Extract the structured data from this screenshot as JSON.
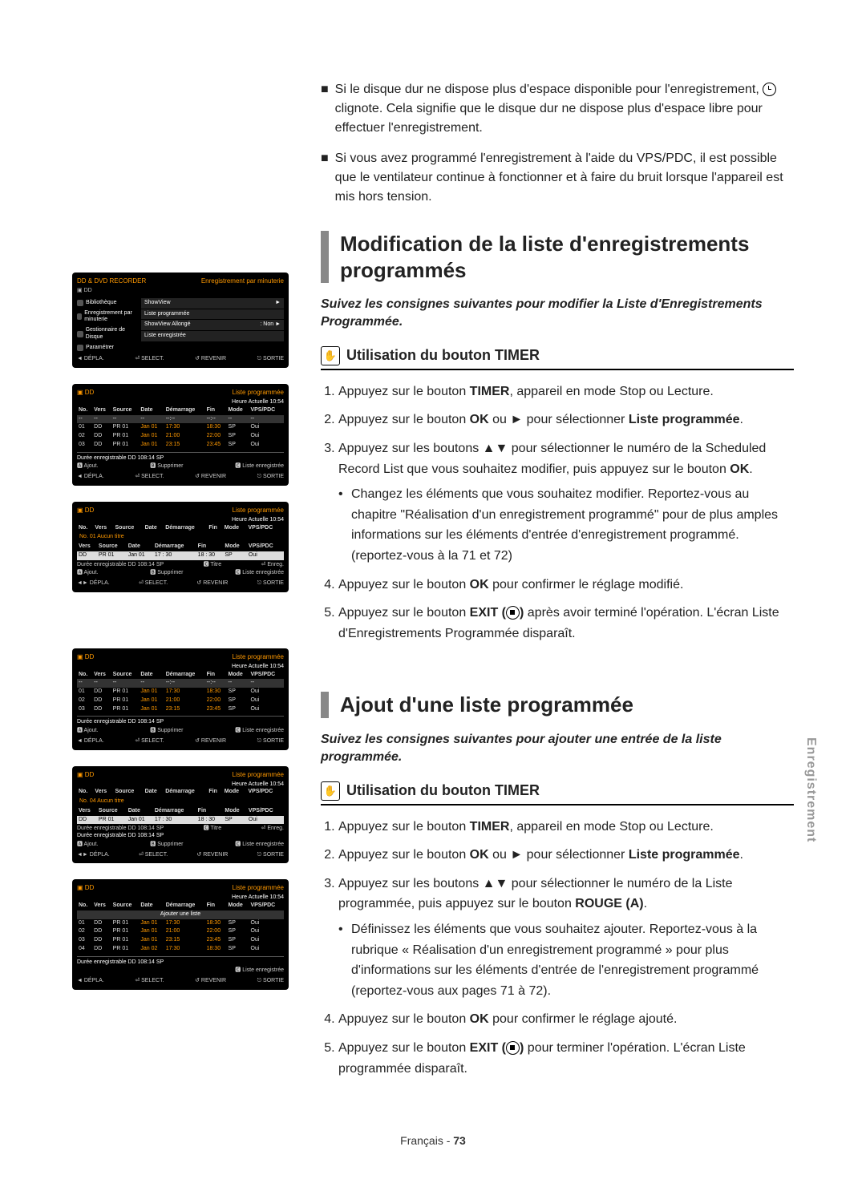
{
  "notes": [
    "Si le disque dur ne dispose plus d'espace disponible pour l'enregistrement, ⊕ clignote. Cela signifie que le disque dur ne dispose plus d'espace libre pour effectuer l'enregistrement.",
    "Si vous avez programmé l'enregistrement à l'aide du VPS/PDC, il est possible que le ventilateur continue à fonctionner et à faire du bruit lorsque l'appareil est mis hors tension."
  ],
  "section1": {
    "title": "Modification de la liste d'enregistrements programmés",
    "intro": "Suivez les consignes suivantes pour modifier la Liste d'Enregistrements Programmée.",
    "subtitle": "Utilisation du bouton TIMER",
    "steps": {
      "s1a": "Appuyez sur le bouton ",
      "s1b": "TIMER",
      "s1c": ", appareil en mode Stop ou Lecture.",
      "s2a": "Appuyez sur le bouton ",
      "s2b": "OK",
      "s2c": " ou ► pour sélectionner ",
      "s2d": "Liste programmée",
      "s2e": ".",
      "s3a": "Appuyez sur les boutons ▲▼ pour sélectionner le numéro de la Scheduled Record List que vous souhaitez modifier, puis appuyez sur le bouton ",
      "s3b": "OK",
      "s3c": ".",
      "s3sub": "Changez les éléments que vous souhaitez modifier. Reportez-vous au chapitre \"Réalisation d'un enregistrement programmé\" pour de plus amples informations sur les éléments d'entrée d'enregistrement programmé. (reportez-vous à la 71 et 72)",
      "s4a": "Appuyez sur le bouton ",
      "s4b": "OK",
      "s4c": " pour confirmer le réglage modifié.",
      "s5a": "Appuyez sur le bouton ",
      "s5b": "EXIT (",
      "s5c": ")",
      "s5d": " après avoir terminé l'opération. L'écran Liste d'Enregistrements Programmée disparaît."
    }
  },
  "section2": {
    "title": "Ajout d'une liste programmée",
    "intro": "Suivez les consignes suivantes pour ajouter une entrée de la liste programmée.",
    "subtitle": "Utilisation du bouton TIMER",
    "steps": {
      "s1a": "Appuyez sur le bouton ",
      "s1b": "TIMER",
      "s1c": ", appareil en mode Stop ou Lecture.",
      "s2a": "Appuyez sur le bouton ",
      "s2b": "OK",
      "s2c": " ou ► pour sélectionner ",
      "s2d": "Liste programmée",
      "s2e": ".",
      "s3a": "Appuyez sur les boutons ▲▼ pour sélectionner le numéro de la Liste programmée, puis appuyez sur le bouton ",
      "s3b": "ROUGE (A)",
      "s3c": ".",
      "s3sub": "Définissez les éléments que vous souhaitez ajouter. Reportez-vous à la rubrique « Réalisation d'un enregistrement programmé » pour plus d'informations sur les éléments d'entrée de l'enregistrement programmé (reportez-vous aux pages 71 à 72).",
      "s4a": "Appuyez sur le bouton ",
      "s4b": "OK",
      "s4c": " pour confirmer le réglage ajouté.",
      "s5a": "Appuyez sur le bouton ",
      "s5b": "EXIT (",
      "s5c": ")",
      "s5d": " pour terminer l'opération. L'écran Liste programmée disparaît."
    }
  },
  "tv1": {
    "title_left": "DD & DVD RECORDER",
    "title_right": "Enregistrement par minuterie",
    "hdd": "DD",
    "left_items": [
      "Bibliothèque",
      "Enregistrement par minuterie",
      "Gestionnaire de Disque",
      "Paramétrer"
    ],
    "right_items": [
      {
        "label": "ShowView",
        "val": "►"
      },
      {
        "label": "Liste programmée",
        "val": ""
      },
      {
        "label": "ShowView Allongé",
        "val": ": Non   ►"
      },
      {
        "label": "Liste enregistrée",
        "val": ""
      }
    ],
    "footer": [
      "◄ DÉPLA.",
      "⏎ SELECT.",
      "↺ REVENIR",
      "⎋ SORTIE"
    ]
  },
  "tv_list_common": {
    "hdd": "DD",
    "title_right": "Liste programmée",
    "time": "Heure Actuelle 10:54",
    "head": [
      "No.",
      "Vers",
      "Source",
      "Date",
      "Démarrage",
      "Fin",
      "Mode",
      "VPS/PDC"
    ],
    "rec_label": "Durée enregistrable  DD 108:14 SP",
    "subfooter": [
      "🅰 Ajout.",
      "🅱 Supprimer",
      "🅲 Liste enregistrée"
    ],
    "footer": [
      "◄ DÉPLA.",
      "⏎ SELECT.",
      "↺ REVENIR",
      "⎋ SORTIE"
    ]
  },
  "tv2_rows": [
    [
      "--",
      "--",
      "--",
      "--",
      "--:--",
      "--:--",
      "--",
      "--"
    ],
    [
      "01",
      "DD",
      "PR 01",
      "Jan 01",
      "17:30",
      "18:30",
      "SP",
      "Oui"
    ],
    [
      "02",
      "DD",
      "PR 01",
      "Jan 01",
      "21:00",
      "22:00",
      "SP",
      "Oui"
    ],
    [
      "03",
      "DD",
      "PR 01",
      "Jan 01",
      "23:15",
      "23:45",
      "SP",
      "Oui"
    ]
  ],
  "tv3": {
    "orange_title": "No. 01 Aucun titre",
    "head2": [
      "Vers",
      "Source",
      "Date",
      "Démarrage",
      "Fin",
      "Mode",
      "VPS/PDC"
    ],
    "row": [
      "DD",
      "PR 01",
      "Jan 01",
      "17 : 30",
      "18 : 30",
      "SP",
      "Oui"
    ],
    "rec_label": "Durée enregistrable  DD 108:14 SP",
    "right_hints": [
      "🅲 Titre",
      "⏎ Enreg."
    ],
    "footer": [
      "◄► DÉPLA.",
      "⏎ SELECT.",
      "↺ REVENIR",
      "⎋ SORTIE"
    ]
  },
  "tv4_rows": [
    [
      "--",
      "--",
      "--",
      "--",
      "--:--",
      "--:--",
      "--",
      "--"
    ],
    [
      "01",
      "DD",
      "PR 01",
      "Jan 01",
      "17:30",
      "18:30",
      "SP",
      "Oui"
    ],
    [
      "02",
      "DD",
      "PR 01",
      "Jan 01",
      "21:00",
      "22:00",
      "SP",
      "Oui"
    ],
    [
      "03",
      "DD",
      "PR 01",
      "Jan 01",
      "23:15",
      "23:45",
      "SP",
      "Oui"
    ]
  ],
  "tv5": {
    "orange_title": "No. 04 Aucun titre",
    "head2": [
      "Vers",
      "Source",
      "Date",
      "Démarrage",
      "Fin",
      "Mode",
      "VPS/PDC"
    ],
    "row": [
      "DD",
      "PR 01",
      "Jan 01",
      "17 : 30",
      "18 : 30",
      "SP",
      "Oui"
    ],
    "rec_label1": "Durée enregistrable  DD 108:14 SP",
    "right_hints": [
      "🅲 Titre",
      "⏎ Enreg."
    ],
    "rec_label2": "Durée enregistrable  DD 108:14 SP",
    "footer": [
      "◄► DÉPLA.",
      "⏎ SELECT.",
      "↺ REVENIR",
      "⎋ SORTIE"
    ]
  },
  "tv6_rows": [
    [
      "",
      "",
      "",
      "",
      "Ajouter une liste",
      "",
      "",
      ""
    ],
    [
      "01",
      "DD",
      "PR 01",
      "Jan 01",
      "17:30",
      "18:30",
      "SP",
      "Oui"
    ],
    [
      "02",
      "DD",
      "PR 01",
      "Jan 01",
      "21:00",
      "22:00",
      "SP",
      "Oui"
    ],
    [
      "03",
      "DD",
      "PR 01",
      "Jan 01",
      "23:15",
      "23:45",
      "SP",
      "Oui"
    ],
    [
      "04",
      "DD",
      "PR 01",
      "Jan 02",
      "17:30",
      "18:30",
      "SP",
      "Oui"
    ]
  ],
  "tv6_subfooter": [
    "",
    "",
    "🅲 Liste enregistrée"
  ],
  "sidetab": "Enregistrement",
  "footer": {
    "lang": "Français - ",
    "page": "73"
  }
}
